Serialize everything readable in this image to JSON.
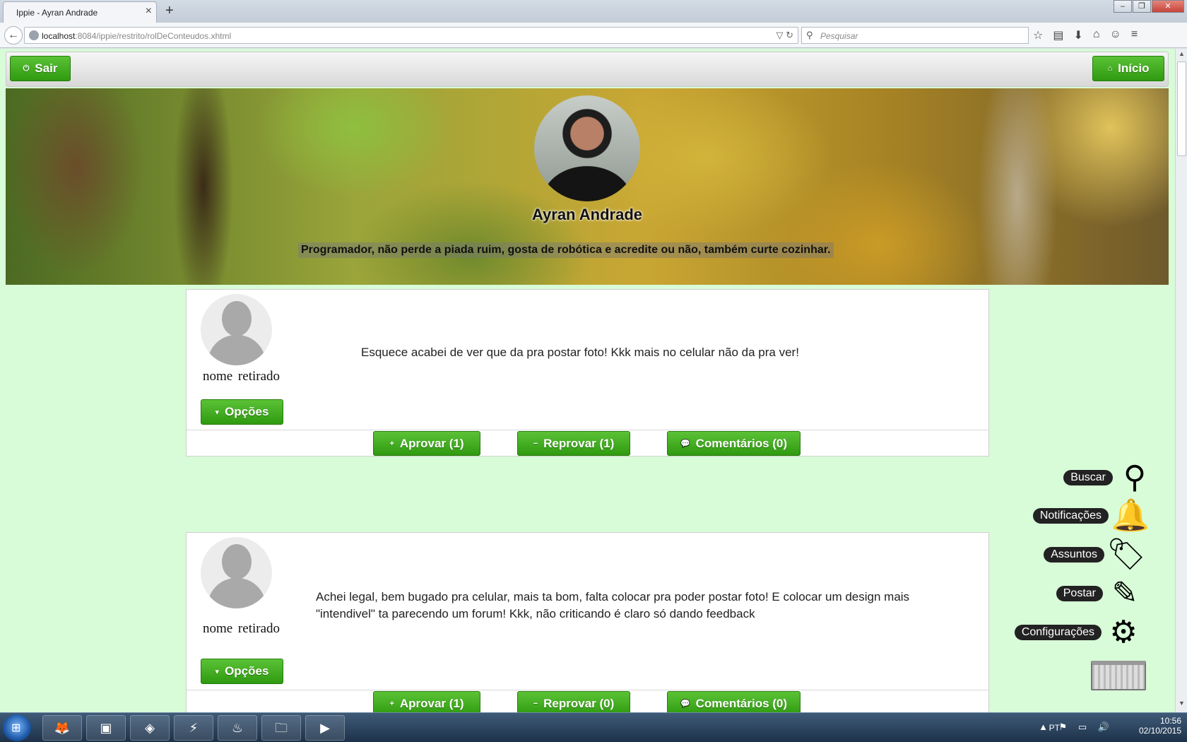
{
  "browser": {
    "tab_title": "Ippie - Ayran Andrade",
    "tab_close": "×",
    "new_tab": "+",
    "window_buttons": [
      "–",
      "❐",
      "✕"
    ],
    "back": "←",
    "url_host": "localhost",
    "url_rest": ":8084/ippie/restrito/rolDeConteudos.xhtml",
    "url_icons": "▽ ↻",
    "search_placeholder": "Pesquisar",
    "toolbar_icons": [
      "☆",
      "▤",
      "⬇",
      "⌂",
      "☺",
      "≡"
    ]
  },
  "header": {
    "logout_label": "Sair",
    "logout_icon": "⏻",
    "home_label": "Início",
    "home_icon": "⌂"
  },
  "profile": {
    "name": "Ayran Andrade",
    "bio": "Programador, não perde a piada ruim, gosta de robótica e acredite ou não, também curte cozinhar."
  },
  "posts": [
    {
      "user": "nome retirado",
      "text": "Esquece acabei de ver que da pra postar foto! Kkk mais no celular não da pra ver!",
      "options_label": "Opções",
      "approve_label": "Aprovar (1)",
      "reject_label": "Reprovar (1)",
      "comments_label": "Comentários (0)"
    },
    {
      "user": "nome retirado",
      "text": "Achei legal, bem bugado pra celular, mais ta bom, falta colocar pra poder postar foto! E colocar um design mais \"intendivel\" ta parecendo um forum! Kkk, não criticando é claro só dando feedback",
      "options_label": "Opções",
      "approve_label": "Aprovar (1)",
      "reject_label": "Reprovar (0)",
      "comments_label": "Comentários (0)"
    }
  ],
  "action_icons": {
    "options": "▾",
    "approve": "+",
    "reject": "−",
    "comments": "💬"
  },
  "side_menu": [
    {
      "label": "Buscar",
      "icon": "search-icon",
      "glyph": "⚲"
    },
    {
      "label": "Notificações",
      "icon": "bell-icon",
      "glyph": "🔔"
    },
    {
      "label": "Assuntos",
      "icon": "tag-icon",
      "glyph": "🏷"
    },
    {
      "label": "Postar",
      "icon": "pencil-icon",
      "glyph": "✎"
    },
    {
      "label": "Configurações",
      "icon": "gear-icon",
      "glyph": "⚙"
    }
  ],
  "taskbar": {
    "start_glyph": "⊞",
    "apps": [
      "firefox-icon",
      "box-icon",
      "visual-studio-icon",
      "mysql-icon",
      "steam-icon",
      "explorer-icon",
      "media-player-icon"
    ],
    "app_glyphs": [
      "🦊",
      "▣",
      "◈",
      "⚡",
      "♨",
      "🗀",
      "▶"
    ],
    "language": "PT",
    "tray_icons": "▲ ⚑ ▭ 🔊",
    "time": "10:56",
    "date": "02/10/2015"
  }
}
